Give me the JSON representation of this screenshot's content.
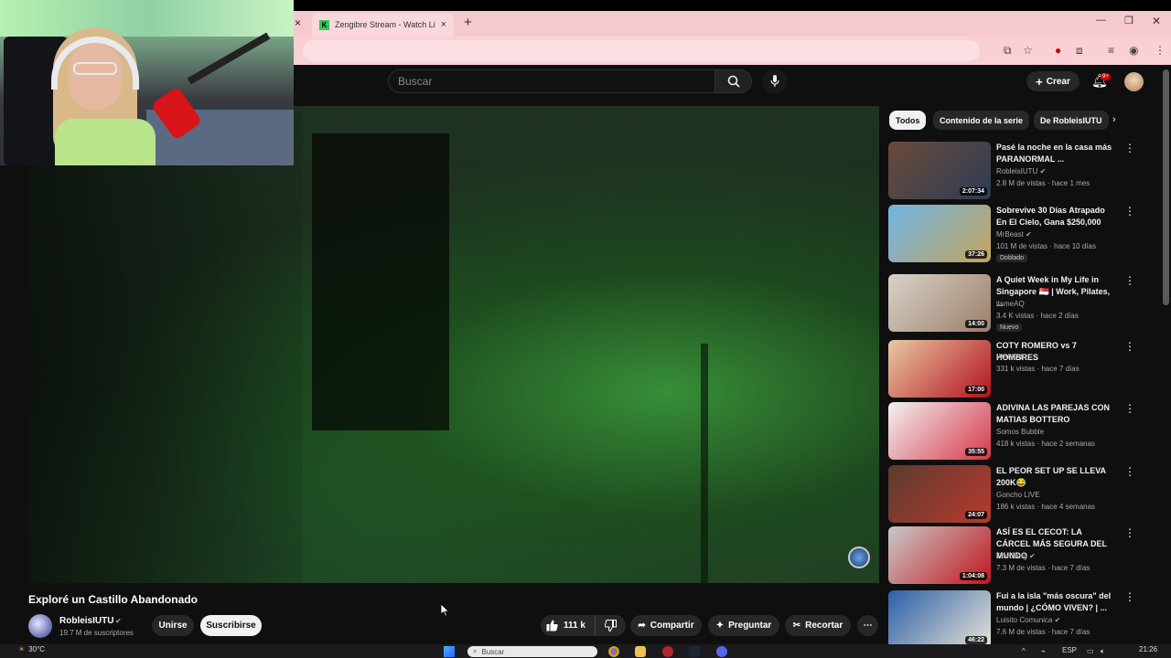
{
  "browser": {
    "tab_title": "Zengibre Stream - Watch Live o",
    "tab_favicon_letter": "K",
    "new_tab": "+",
    "close_glyph": "×"
  },
  "youtube": {
    "search_placeholder": "Buscar",
    "create_label": "Crear",
    "notif_badge": "9+",
    "video": {
      "title": "Exploré un Castillo Abandonado",
      "channel": "RobleisIUTU",
      "subscribers": "19.7 M de suscriptores",
      "join_label": "Unirse",
      "subscribe_label": "Suscribirse",
      "likes": "111 k",
      "share_label": "Compartir",
      "ask_label": "Preguntar",
      "clip_label": "Recortar"
    },
    "chips": [
      "Todos",
      "Contenido de la serie",
      "De RobleisIUTU"
    ],
    "recommendations": [
      {
        "title": "Pasé la noche en la casa más PARANORMAL ...",
        "channel": "RobleisIUTU",
        "verified": true,
        "meta": "2.8 M de vistas · hace 1 mes",
        "duration": "2:07:34",
        "badge": "",
        "colors": [
          "#6b4a3a",
          "#2c3d55"
        ]
      },
      {
        "title": "Sobrevive 30 Días Atrapado En El Cielo, Gana $250,000",
        "channel": "MrBeast",
        "verified": true,
        "meta": "101 M de vistas · hace 10 días",
        "duration": "37:26",
        "badge": "Doblado",
        "colors": [
          "#6fb5e8",
          "#c4a45a"
        ]
      },
      {
        "title": "A Quiet Week in My Life in Singapore 🇸🇬 | Work, Pilates, ...",
        "channel": "itsmeAQ",
        "verified": false,
        "meta": "3.4 K vistas · hace 2 días",
        "duration": "14:00",
        "badge": "Nuevo",
        "colors": [
          "#d9d2c8",
          "#9a7f6a"
        ]
      },
      {
        "title": "COTY ROMERO vs 7 HOMBRES",
        "channel": "WANDII",
        "verified": false,
        "meta": "331 k vistas · hace 7 días",
        "duration": "17:00",
        "badge": "",
        "colors": [
          "#e9c9a4",
          "#b3121e"
        ]
      },
      {
        "title": "ADIVINA LAS PAREJAS CON MATIAS BOTTERO",
        "channel": "Somos Bubble",
        "verified": false,
        "meta": "418 k vistas · hace 2 semanas",
        "duration": "35:55",
        "badge": "",
        "colors": [
          "#f2f2f2",
          "#d6384a"
        ]
      },
      {
        "title": "EL PEOR SET UP SE LLEVA 200K😂",
        "channel": "Goncho LIVE",
        "verified": false,
        "meta": "186 k vistas · hace 4 semanas",
        "duration": "24:07",
        "badge": "",
        "colors": [
          "#5b3b2f",
          "#b93a2e"
        ]
      },
      {
        "title": "ASÍ ES EL CECOT: LA CÁRCEL MÁS SEGURA DEL MUNDO",
        "channel": "TheGrefg",
        "verified": true,
        "meta": "7.3 M de vistas · hace 7 días",
        "duration": "1:04:08",
        "badge": "",
        "colors": [
          "#c9c9c9",
          "#c2161e"
        ]
      },
      {
        "title": "Fui a la isla \"más oscura\" del mundo | ¿CÓMO VIVEN? | ...",
        "channel": "Luisito Comunica",
        "verified": true,
        "meta": "7.6 M de vistas · hace 7 días",
        "duration": "46:22",
        "badge": "",
        "colors": [
          "#2a5fa8",
          "#e8e2d6"
        ]
      }
    ]
  },
  "taskbar": {
    "temperature": "30°C",
    "search_placeholder": "Buscar",
    "language": "ESP",
    "time": "21:26"
  }
}
